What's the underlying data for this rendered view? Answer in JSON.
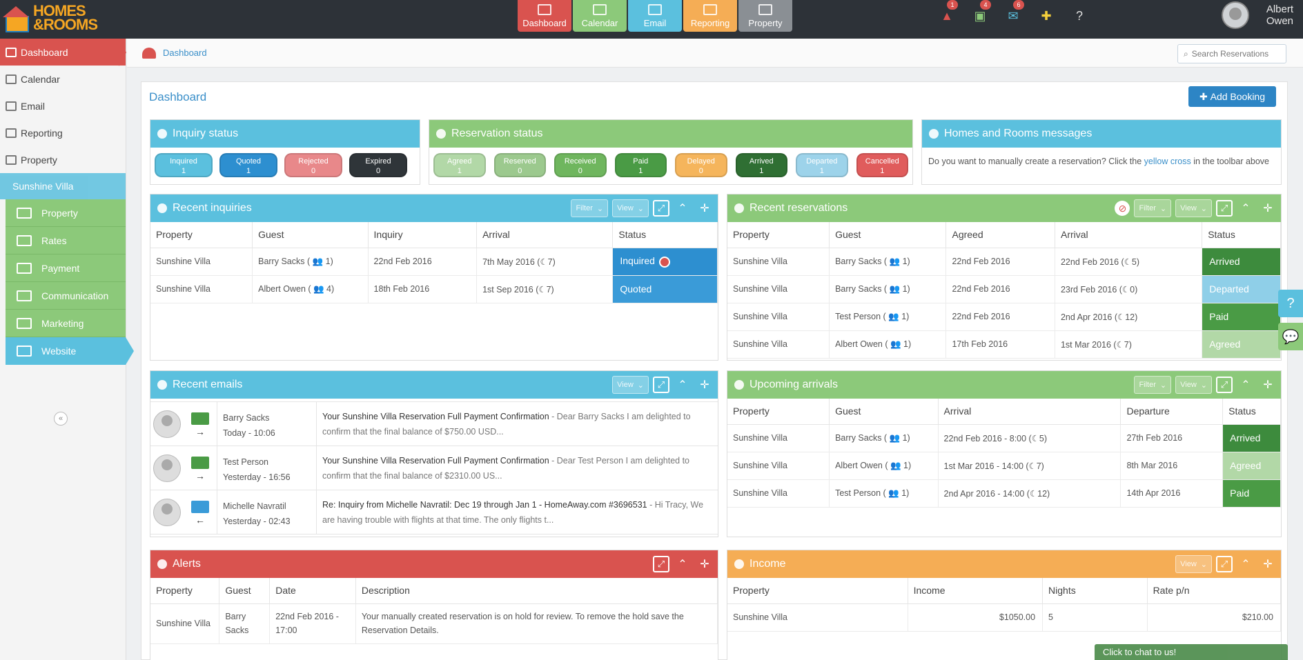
{
  "app": {
    "logo_text": "HOMES &ROOMS"
  },
  "topnav": {
    "tabs": [
      {
        "label": "Dashboard",
        "color": "#d9534f"
      },
      {
        "label": "Calendar",
        "color": "#8cc97a"
      },
      {
        "label": "Email",
        "color": "#5bc0de"
      },
      {
        "label": "Reporting",
        "color": "#f5ad55"
      },
      {
        "label": "Property",
        "color": "#8a8f94"
      }
    ],
    "icons": [
      {
        "name": "alert-icon",
        "glyph": "▲",
        "badge": "1",
        "color": "#d9534f"
      },
      {
        "name": "briefcase-icon",
        "glyph": "▣",
        "badge": "4",
        "color": "#8cc97a"
      },
      {
        "name": "mail-icon",
        "glyph": "✉",
        "badge": "6",
        "color": "#5bc0de"
      },
      {
        "name": "plus-icon",
        "glyph": "✚",
        "badge": "",
        "color": "#f5d03c"
      },
      {
        "name": "help-icon",
        "glyph": "?",
        "badge": "",
        "color": "#dddddd"
      }
    ],
    "user_name": "Albert Owen"
  },
  "sidebar": {
    "items": [
      {
        "label": "Dashboard",
        "active": true
      },
      {
        "label": "Calendar"
      },
      {
        "label": "Email"
      },
      {
        "label": "Reporting"
      },
      {
        "label": "Property"
      }
    ],
    "property_name": "Sunshine Villa",
    "sub_items": [
      "Property",
      "Rates",
      "Payment",
      "Communication",
      "Marketing",
      "Website"
    ],
    "collapse_glyph": "«"
  },
  "breadcrumb": {
    "label": "Dashboard",
    "search_label": "Search Reservations"
  },
  "page": {
    "title": "Dashboard",
    "add_booking_label": "Add Booking"
  },
  "inquiry_status": {
    "title": "Inquiry status",
    "pills": [
      {
        "label": "Inquired",
        "count": "1",
        "color": "#5bc0de"
      },
      {
        "label": "Quoted",
        "count": "1",
        "color": "#2d8fd0"
      },
      {
        "label": "Rejected",
        "count": "0",
        "color": "#e8888a"
      },
      {
        "label": "Expired",
        "count": "0",
        "color": "#2f3539"
      }
    ]
  },
  "reservation_status": {
    "title": "Reservation status",
    "pills": [
      {
        "label": "Agreed",
        "count": "1",
        "color": "#b2d8a7"
      },
      {
        "label": "Reserved",
        "count": "0",
        "color": "#9cc98e"
      },
      {
        "label": "Received",
        "count": "0",
        "color": "#6fb65e"
      },
      {
        "label": "Paid",
        "count": "1",
        "color": "#4a9b45"
      },
      {
        "label": "Delayed",
        "count": "0",
        "color": "#f5b55c"
      },
      {
        "label": "Arrived",
        "count": "1",
        "color": "#2f6f33"
      },
      {
        "label": "Departed",
        "count": "1",
        "color": "#9dd3ea"
      },
      {
        "label": "Cancelled",
        "count": "1",
        "color": "#e05c5c"
      }
    ]
  },
  "messages": {
    "title": "Homes and Rooms messages",
    "text_before": "Do you want to manually create a reservation? Click the ",
    "link": "yellow cross",
    "text_after": " in the toolbar above"
  },
  "recent_inquiries": {
    "title": "Recent inquiries",
    "filter_label": "Filter",
    "view_label": "View",
    "columns": [
      "Property",
      "Guest",
      "Inquiry",
      "Arrival",
      "Status"
    ],
    "rows": [
      {
        "property": "Sunshine Villa",
        "guest": "Barry Sacks ( 👥 1)",
        "inquiry": "22nd Feb 2016",
        "arrival": "7th May 2016 (☾7)",
        "status": "Inquired",
        "status_class": "st-inquired",
        "icon": true
      },
      {
        "property": "Sunshine Villa",
        "guest": "Albert Owen ( 👥 4)",
        "inquiry": "18th Feb 2016",
        "arrival": "1st Sep 2016 (☾7)",
        "status": "Quoted",
        "status_class": "st-quoted",
        "icon": false
      }
    ]
  },
  "recent_reservations": {
    "title": "Recent reservations",
    "filter_label": "Filter",
    "view_label": "View",
    "columns": [
      "Property",
      "Guest",
      "Agreed",
      "Arrival",
      "Status"
    ],
    "rows": [
      {
        "property": "Sunshine Villa",
        "guest": "Barry Sacks ( 👥 1)",
        "agreed": "22nd Feb 2016",
        "arrival": "22nd Feb 2016 (☾5)",
        "status": "Arrived",
        "status_class": "st-arrived"
      },
      {
        "property": "Sunshine Villa",
        "guest": "Barry Sacks ( 👥 1)",
        "agreed": "22nd Feb 2016",
        "arrival": "23rd Feb 2016 (☾0)",
        "status": "Departed",
        "status_class": "st-departed"
      },
      {
        "property": "Sunshine Villa",
        "guest": "Test Person ( 👥 1)",
        "agreed": "22nd Feb 2016",
        "arrival": "2nd Apr 2016 (☾12)",
        "status": "Paid",
        "status_class": "st-paid"
      },
      {
        "property": "Sunshine Villa",
        "guest": "Albert Owen ( 👥 1)",
        "agreed": "17th Feb 2016",
        "arrival": "1st Mar 2016 (☾7)",
        "status": "Agreed",
        "status_class": "st-agreed"
      }
    ]
  },
  "recent_emails": {
    "title": "Recent emails",
    "view_label": "View",
    "rows": [
      {
        "from": "Barry Sacks",
        "time": "Today - 10:06",
        "subject": "Your Sunshine Villa Reservation Full Payment Confirmation",
        "snippet": " - Dear Barry Sacks I am delighted to confirm that the final balance of $750.00 USD...",
        "env_color": "#4a9b45",
        "arrow": "→"
      },
      {
        "from": "Test Person",
        "time": "Yesterday - 16:56",
        "subject": "Your Sunshine Villa Reservation Full Payment Confirmation",
        "snippet": " - Dear Test Person I am delighted to confirm that the final balance of $2310.00 US...",
        "env_color": "#4a9b45",
        "arrow": "→"
      },
      {
        "from": "Michelle Navratil",
        "time": "Yesterday - 02:43",
        "subject": "Re: Inquiry from Michelle Navratil: Dec 19 through Jan 1 - HomeAway.com #3696531",
        "snippet": " - Hi Tracy, We are having trouble with flights at that time. The only flights t...",
        "env_color": "#3a9bd8",
        "arrow": "←"
      }
    ]
  },
  "upcoming_arrivals": {
    "title": "Upcoming arrivals",
    "filter_label": "Filter",
    "view_label": "View",
    "columns": [
      "Property",
      "Guest",
      "Arrival",
      "Departure",
      "Status"
    ],
    "rows": [
      {
        "property": "Sunshine Villa",
        "guest": "Barry Sacks ( 👥 1)",
        "arrival": "22nd Feb 2016 - 8:00 (☾5)",
        "departure": "27th Feb 2016",
        "status": "Arrived",
        "status_class": "st-arrived"
      },
      {
        "property": "Sunshine Villa",
        "guest": "Albert Owen ( 👥 1)",
        "arrival": "1st Mar 2016 - 14:00 (☾7)",
        "departure": "8th Mar 2016",
        "status": "Agreed",
        "status_class": "st-agreed"
      },
      {
        "property": "Sunshine Villa",
        "guest": "Test Person ( 👥 1)",
        "arrival": "2nd Apr 2016 - 14:00 (☾12)",
        "departure": "14th Apr 2016",
        "status": "Paid",
        "status_class": "st-paid"
      }
    ]
  },
  "alerts": {
    "title": "Alerts",
    "columns": [
      "Property",
      "Guest",
      "Date",
      "Description"
    ],
    "rows": [
      {
        "property": "Sunshine Villa",
        "guest": "Barry Sacks",
        "date": "22nd Feb 2016 - 17:00",
        "description": "Your manually created reservation is on hold for review. To remove the hold save the Reservation Details."
      }
    ]
  },
  "income": {
    "title": "Income",
    "view_label": "View",
    "columns": [
      "Property",
      "Income",
      "Nights",
      "Rate p/n"
    ],
    "rows": [
      {
        "property": "Sunshine Villa",
        "income": "$1050.00",
        "nights": "5",
        "rate": "$210.00"
      }
    ]
  },
  "chat": {
    "label": "Click to chat to us!"
  },
  "side_tabs": {
    "help_glyph": "?",
    "feedback_glyph": "💬"
  }
}
